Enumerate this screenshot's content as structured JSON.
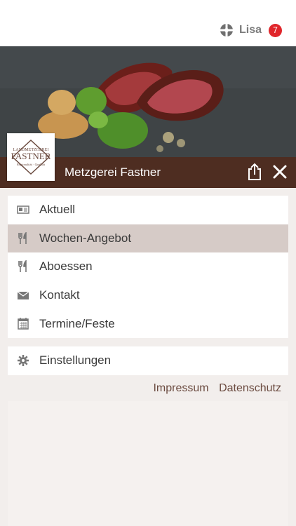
{
  "user": {
    "name": "Lisa",
    "badge": "7"
  },
  "header": {
    "title": "Metzgerei Fastner"
  },
  "menu": [
    {
      "label": "Aktuell",
      "icon": "news-icon"
    },
    {
      "label": "Wochen-Angebot",
      "icon": "cutlery-icon"
    },
    {
      "label": "Aboessen",
      "icon": "cutlery-icon"
    },
    {
      "label": "Kontakt",
      "icon": "envelope-icon"
    },
    {
      "label": "Termine/Feste",
      "icon": "calendar-icon"
    }
  ],
  "settings": {
    "label": "Einstellungen",
    "icon": "gear-icon"
  },
  "footer": {
    "impressum": "Impressum",
    "datenschutz": "Datenschutz"
  },
  "logo": {
    "line1": "LANDMETZGEREI",
    "line2": "FASTNER",
    "line3": "Regionalität · Qualität"
  },
  "colors": {
    "header": "#4e2d21",
    "active": "#d6cbc7",
    "badge": "#e0262b",
    "link": "#6b4b40"
  }
}
